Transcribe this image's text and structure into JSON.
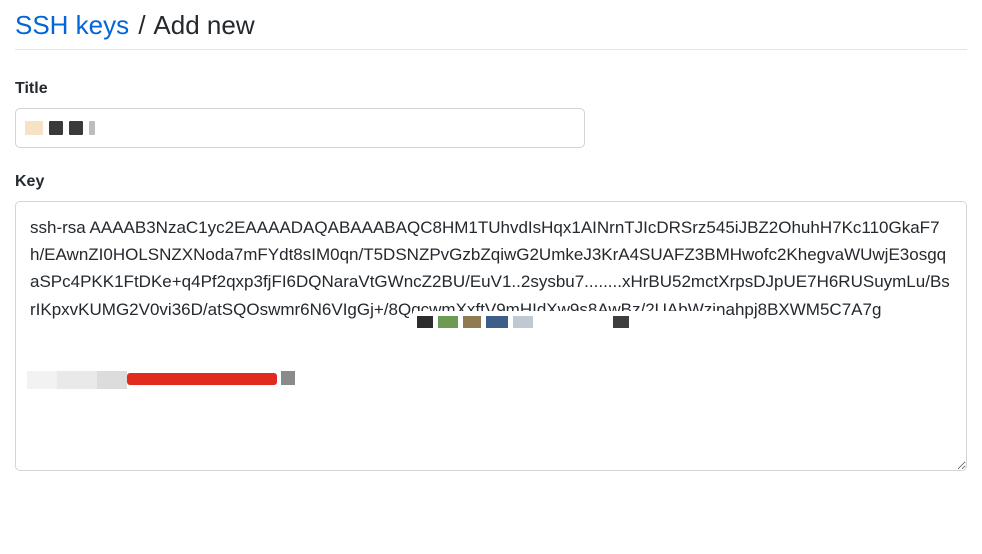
{
  "breadcrumb": {
    "link_text": "SSH keys",
    "separator": "/",
    "current": "Add new"
  },
  "form": {
    "title": {
      "label": "Title",
      "value": "",
      "placeholder": ""
    },
    "key": {
      "label": "Key",
      "value": "ssh-rsa AAAAB3NzaC1yc2EAAAADAQABAAABAQC8HM1TUhvdIsHqx1AINrnTJIcDRSrz545iJBZ2OhuhH7Kc110GkaF7h/EAwnZI0HOLSNZXNoda7mFYdt8sIM0qn/T5DSNZPvGzbZqiwG2UmkeJ3KrA4SUAFZ3BMHwofc2KhegvaWUwjE3osgqaSPc4PKK1FtDKe+q4Pf2qxp3fjFI6DQNaraVtGWncZ2BU/EuV1..2sysbu7........xHrBU52mctXrpsDJpUE7H6RUSuymLu/BsrIKpxvKUMG2V0vi36D/atSQOswmr6N6VIgGj+/8QqcwmXxftV9mHIdXw9s8AwBz/2UAbWzjnahpj8BXWM5C7A7g",
      "placeholder": ""
    }
  }
}
